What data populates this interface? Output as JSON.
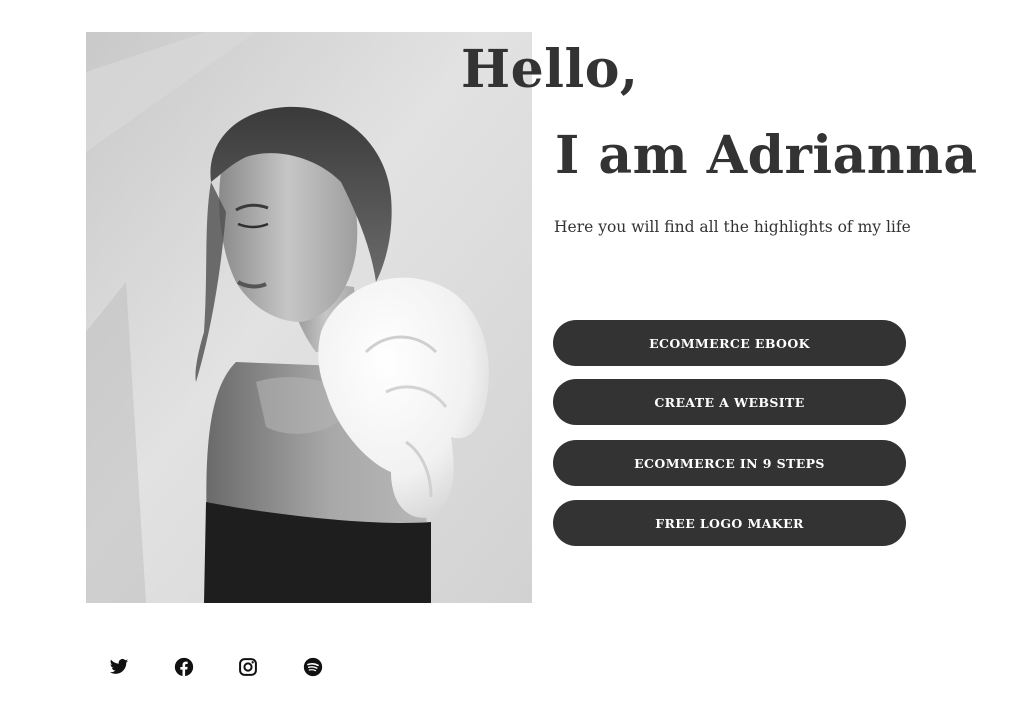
{
  "header": {
    "greeting": "Hello,",
    "name_line": "I am Adrianna",
    "tagline": "Here you will find all the highlights of my life"
  },
  "profile_photo": {
    "description_icon": "portrait-photo"
  },
  "links": [
    {
      "label": "ECOMMERCE EBOOK"
    },
    {
      "label": "CREATE A WEBSITE"
    },
    {
      "label": "ECOMMERCE IN 9 STEPS"
    },
    {
      "label": "FREE LOGO MAKER"
    }
  ],
  "socials": [
    {
      "icon": "twitter-icon"
    },
    {
      "icon": "facebook-icon"
    },
    {
      "icon": "instagram-icon"
    },
    {
      "icon": "spotify-icon"
    }
  ],
  "colors": {
    "text": "#333333",
    "button_bg": "#333333",
    "button_text": "#ffffff",
    "background": "#ffffff"
  }
}
